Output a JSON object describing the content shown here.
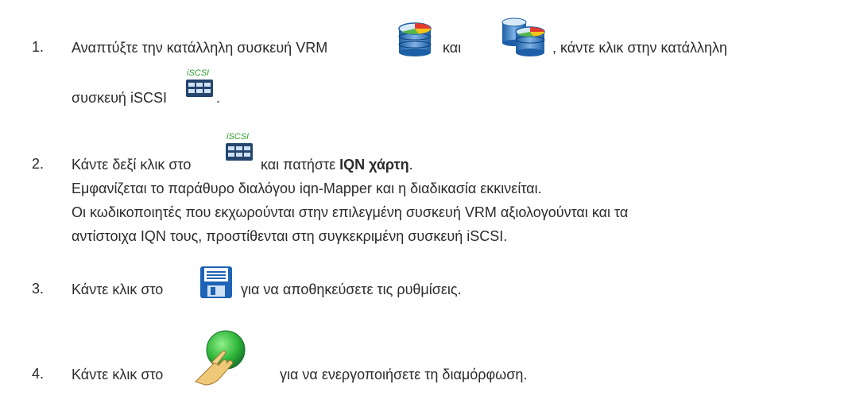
{
  "header_fragment": "",
  "steps": [
    {
      "number": "1.",
      "text_a": "Αναπτύξτε την κατάλληλη συσκευή VRM",
      "text_b": "και",
      "text_c": ", κάντε κλικ στην κατάλληλη",
      "text_d": "συσκευή iSCSI",
      "text_e": "."
    },
    {
      "number": "2.",
      "text_a": "Κάντε δεξί κλικ στο",
      "text_b": "και πατήστε",
      "bold": "IQN χάρτη",
      "text_c": ".",
      "sub1": "Εμφανίζεται το παράθυρο διαλόγου iqn-Mapper και η διαδικασία εκκινείται.",
      "sub2": "Οι κωδικοποιητές που εκχωρούνται στην επιλεγμένη συσκευή VRM αξιολογούνται και τα",
      "sub3": "αντίστοιχα IQN τους, προστίθενται στη συγκεκριμένη συσκευή iSCSI."
    },
    {
      "number": "3.",
      "text_a": "Κάντε κλικ στο",
      "text_b": "για να αποθηκεύσετε τις ρυθμίσεις."
    },
    {
      "number": "4.",
      "text_a": "Κάντε κλικ στο",
      "text_b": "για να ενεργοποιήσετε τη διαμόρφωση."
    }
  ],
  "icons": {
    "vrm": "vrm-device-icon",
    "vrm_secondary": "secondary-vrm-device-icon",
    "iscsi": "iscsi-device-icon",
    "iscsi_label": "iSCSI",
    "save": "save-icon",
    "activate": "activate-icon"
  }
}
